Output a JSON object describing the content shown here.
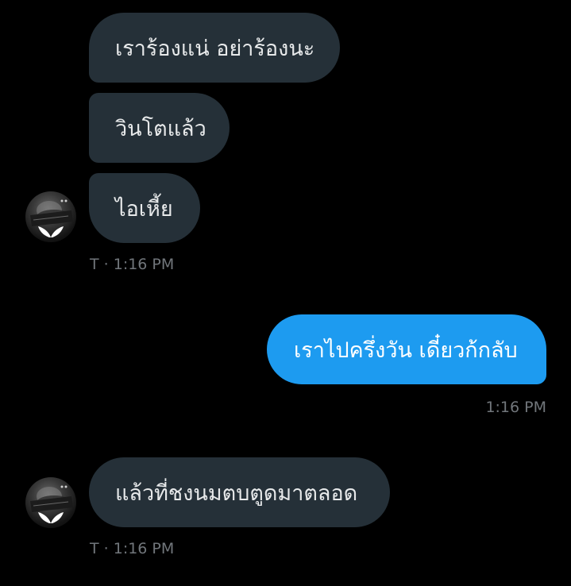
{
  "conversation": {
    "messages": [
      {
        "side": "incoming",
        "text": "เราร้องแน่ อย่าร้องนะ"
      },
      {
        "side": "incoming",
        "text": "วินโตแล้ว"
      },
      {
        "side": "incoming",
        "text": "ไอเหี้ย"
      },
      {
        "side": "outgoing",
        "text": "เราไปครึ่งวัน เดี๋ยวก้กลับ"
      },
      {
        "side": "incoming",
        "text": "แล้วที่ชงนมตบตูดมาตลอด"
      }
    ],
    "timestamps": [
      {
        "text": "T · 1:16 PM"
      },
      {
        "text": "1:16 PM"
      },
      {
        "text": "T · 1:16 PM"
      }
    ]
  },
  "colors": {
    "background": "#000000",
    "incoming_bubble": "#253038",
    "outgoing_bubble": "#1d9bf0",
    "timestamp_text": "#71767b"
  },
  "icons": {
    "avatar": "user-avatar",
    "avatar_mark": "butterfly-icon"
  }
}
